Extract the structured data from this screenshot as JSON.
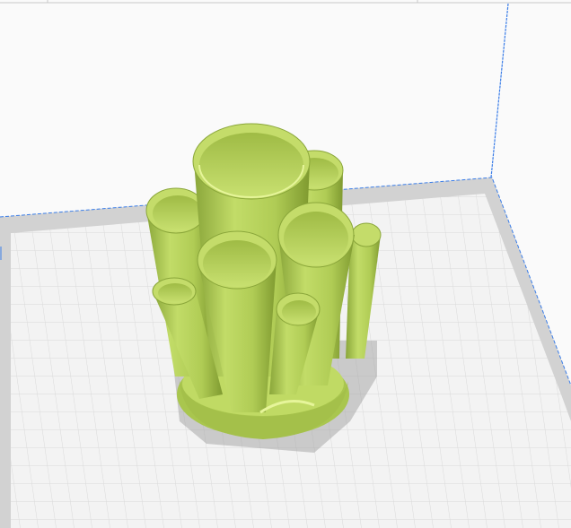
{
  "viewport": {
    "background_color": "#fafafa",
    "build_plate_color": "#f0f0f0",
    "build_plate_border_color": "#d2d2d2",
    "grid_color": "#dcdcdc",
    "volume_edge_color": "#3a7de8",
    "model_color": "#b5d45a",
    "model_shadow_color": "#7f9a30",
    "model_highlight_color": "#e6f59a"
  }
}
